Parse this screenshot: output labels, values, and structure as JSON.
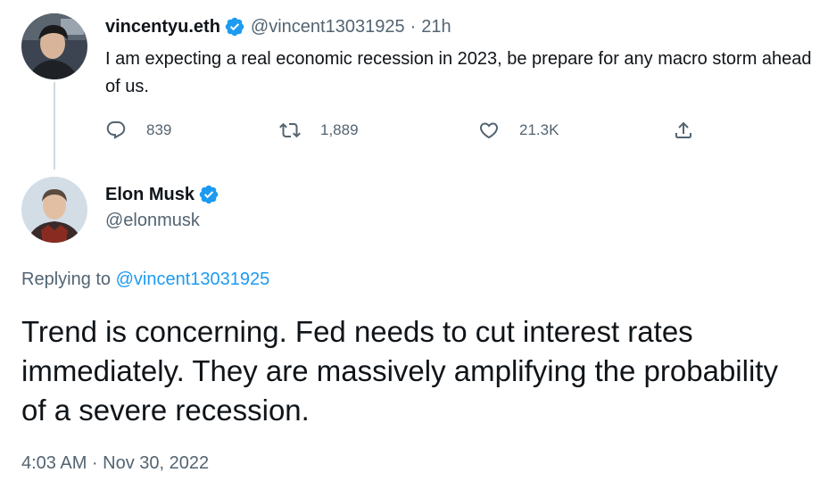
{
  "parent_tweet": {
    "display_name": "vincentyu.eth",
    "handle": "@vincent13031925",
    "separator": "·",
    "time_ago": "21h",
    "text": "I am expecting a real economic recession in 2023, be prepare for any macro storm ahead of us.",
    "stats": {
      "replies": "839",
      "retweets": "1,889",
      "likes": "21.3K"
    },
    "verified": true
  },
  "reply_tweet": {
    "display_name": "Elon Musk",
    "handle": "@elonmusk",
    "verified": true,
    "replying_prefix": "Replying to",
    "replying_handle": "@vincent13031925",
    "text": "Trend is concerning. Fed needs to cut interest rates immediately. They are massively amplifying the probability of a severe recession.",
    "timestamp": "4:03 AM · Nov 30, 2022"
  },
  "icons": {
    "verified": "verified-badge-icon",
    "reply": "comment-icon",
    "retweet": "retweet-icon",
    "like": "heart-icon",
    "share": "share-icon"
  },
  "colors": {
    "text": "#0f1419",
    "muted": "#536471",
    "link": "#1d9bf0",
    "verified": "#1d9bf0",
    "thread_line": "#cfd9de"
  }
}
